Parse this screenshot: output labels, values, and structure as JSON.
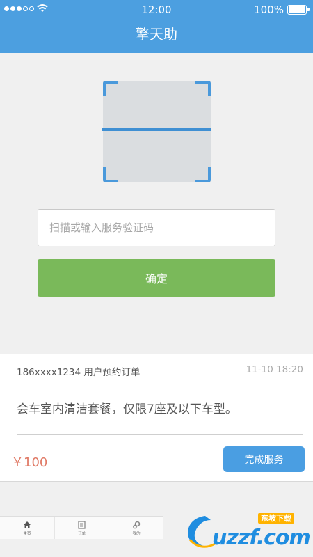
{
  "status_bar": {
    "signal_bars_filled": 3,
    "signal_bars_total": 5,
    "time": "12:00",
    "battery": "100%",
    "battery_level": 1.0
  },
  "nav": {
    "title": "擎天助"
  },
  "scanner": {
    "icon": "qr-scan-frame"
  },
  "verify": {
    "placeholder": "扫描或输入服务验证码",
    "confirm_label": "确定"
  },
  "order": {
    "user_line": "186xxxx1234 用户预约订单",
    "time": "11-10 18:20",
    "description": "会车室内清洁套餐，仅限7座及以下车型。",
    "price": "￥100",
    "complete_label": "完成服务"
  },
  "tabs": [
    {
      "label": "主页",
      "icon": "home-icon"
    },
    {
      "label": "订单",
      "icon": "orders-icon"
    },
    {
      "label": "我的",
      "icon": "settings-icon"
    }
  ],
  "watermark": {
    "badge": "东坡下载",
    "text": "uzzf.com"
  },
  "colors": {
    "primary": "#4c9fe0",
    "confirm": "#7ab95a",
    "price": "#e07a66"
  }
}
